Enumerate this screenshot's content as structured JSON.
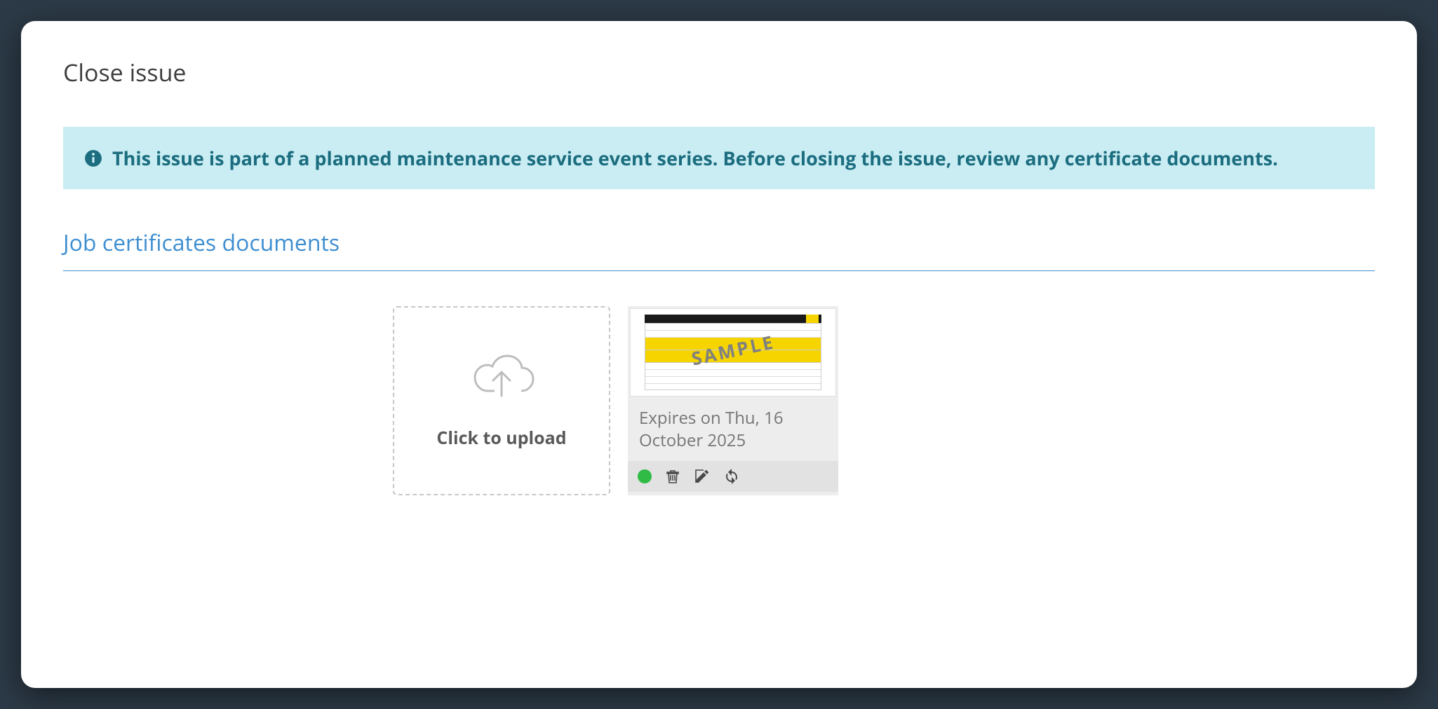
{
  "modal": {
    "title": "Close issue"
  },
  "alert": {
    "message": "This issue is part of a planned maintenance service event series. Before closing the issue, review any certificate documents."
  },
  "section": {
    "heading": "Job certificates documents"
  },
  "upload": {
    "label": "Click to upload"
  },
  "document": {
    "thumbnail_watermark": "SAMPLE",
    "expires_text": "Expires on Thu, 16 October 2025",
    "status_color": "#2fbb45"
  }
}
